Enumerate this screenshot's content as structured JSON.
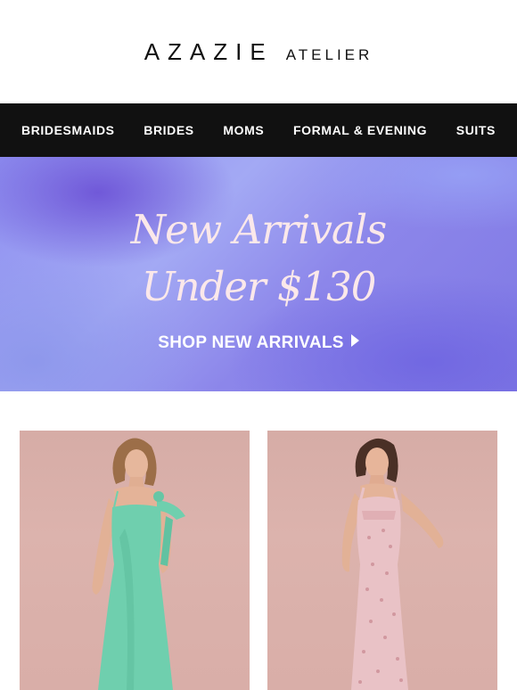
{
  "brand": {
    "name": "AZAZIE",
    "sub": "ATELIER"
  },
  "nav": {
    "items": [
      {
        "label": "BRIDESMAIDS"
      },
      {
        "label": "BRIDES"
      },
      {
        "label": "MOMS"
      },
      {
        "label": "FORMAL & EVENING"
      },
      {
        "label": "SUITS"
      }
    ]
  },
  "hero": {
    "title_line1": "New Arrivals",
    "title_line2": "Under $130",
    "cta": "SHOP NEW ARRIVALS"
  },
  "products": [
    {
      "dress_color": "#6fcfae",
      "background": "#d9aea8"
    },
    {
      "dress_color": "#e9c2c6",
      "background": "#d9aea8"
    }
  ],
  "colors": {
    "nav_bg": "#111111",
    "hero_text": "#fbe8ea",
    "accent": "#8c86ea"
  }
}
